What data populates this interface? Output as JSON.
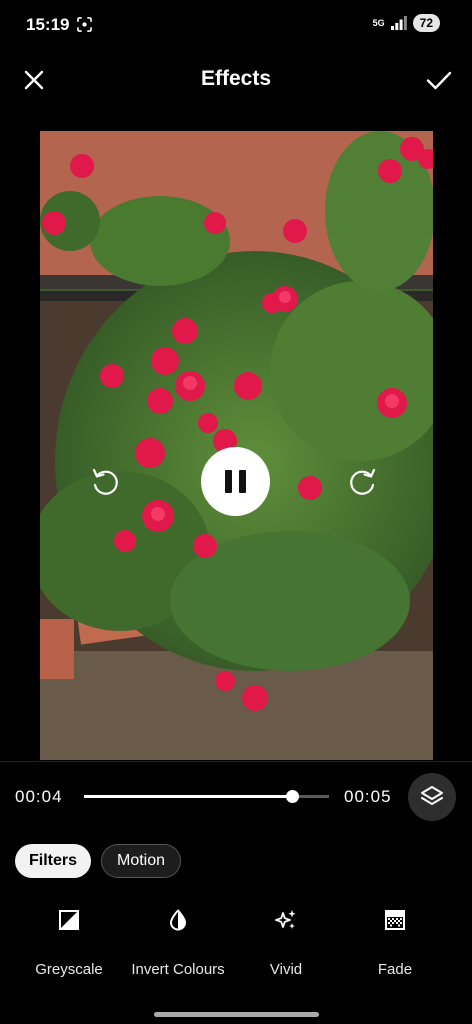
{
  "status": {
    "time": "15:19",
    "network": "5G",
    "battery": "72"
  },
  "header": {
    "title": "Effects"
  },
  "player": {
    "current_time": "00:04",
    "total_time": "00:05",
    "progress": 0.85
  },
  "tabs": [
    {
      "label": "Filters",
      "selected": true
    },
    {
      "label": "Motion",
      "selected": false
    }
  ],
  "effects": [
    {
      "label": "Greyscale",
      "icon": "greyscale-icon"
    },
    {
      "label": "Invert Colours",
      "icon": "invert-icon"
    },
    {
      "label": "Vivid",
      "icon": "sparkle-icon"
    },
    {
      "label": "Fade",
      "icon": "fade-icon"
    }
  ]
}
